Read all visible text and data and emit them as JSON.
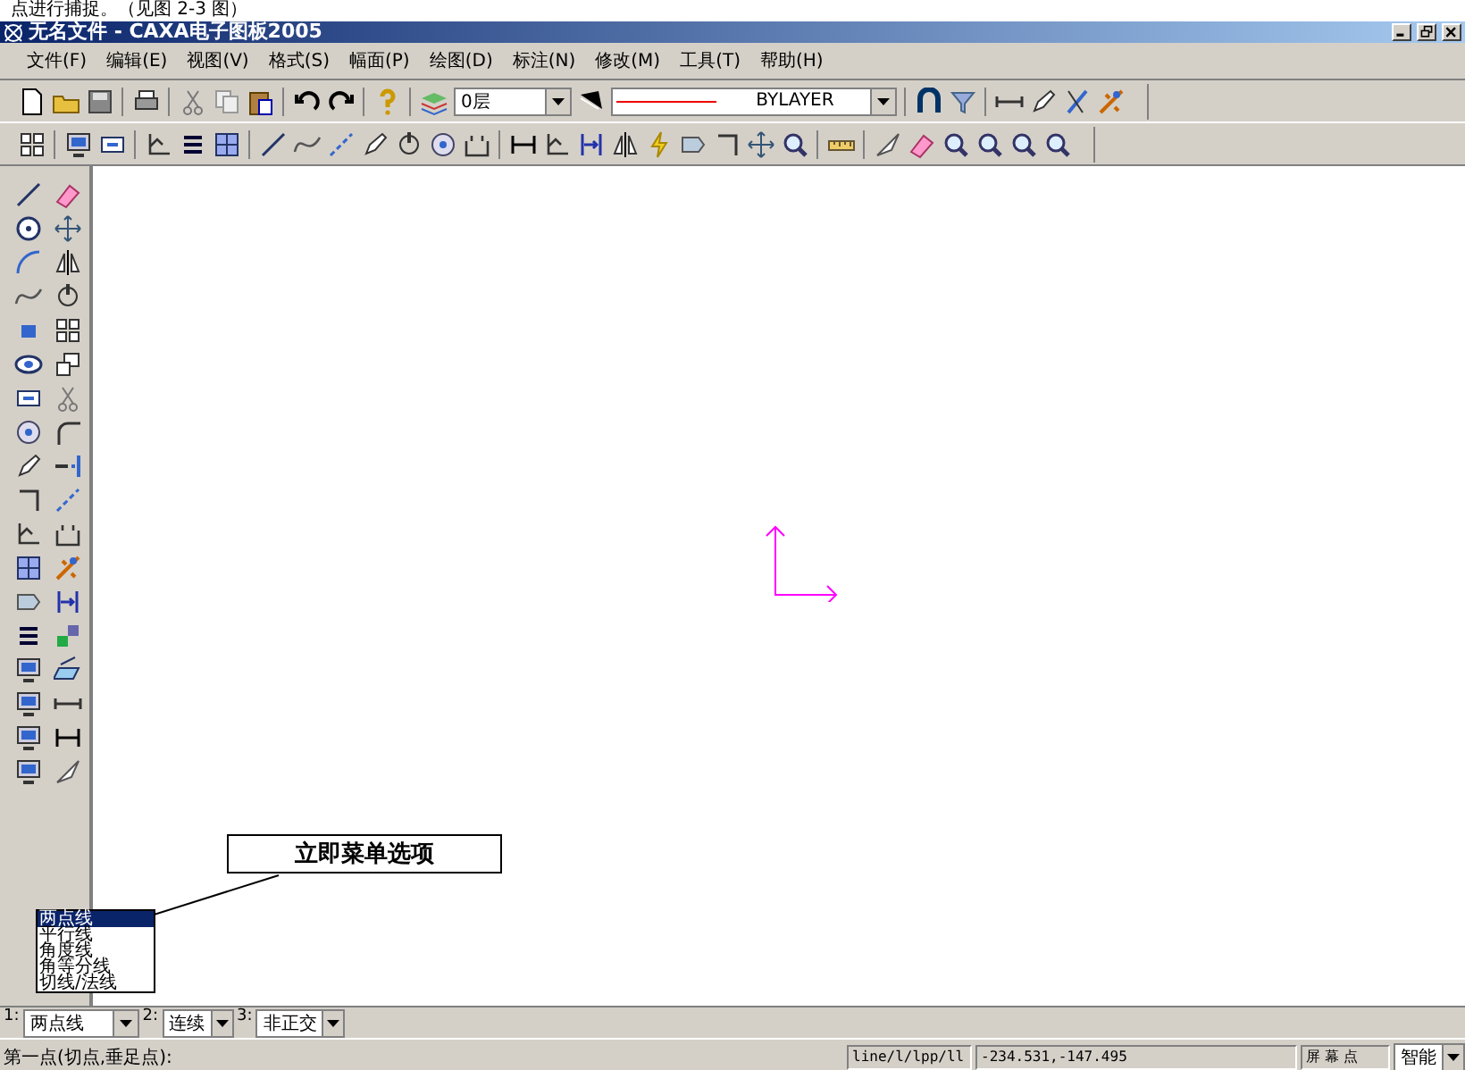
{
  "caption": "点进行捕捉。（见图 2-3 图）",
  "window": {
    "title": "无名文件 - CAXA电子图板2005"
  },
  "menu": [
    "文件(F)",
    "编辑(E)",
    "视图(V)",
    "格式(S)",
    "幅面(P)",
    "绘图(D)",
    "标注(N)",
    "修改(M)",
    "工具(T)",
    "帮助(H)"
  ],
  "toolbar": {
    "layer": "0层",
    "linetype": "BYLAYER"
  },
  "callout": {
    "text": "立即菜单选项"
  },
  "option_list": [
    {
      "label": "两点线",
      "selected": true
    },
    {
      "label": "平行线",
      "selected": false
    },
    {
      "label": "角度线",
      "selected": false
    },
    {
      "label": "角等分线",
      "selected": false
    },
    {
      "label": "切线/法线",
      "selected": false
    }
  ],
  "immediate_menu": [
    {
      "index": "1:",
      "value": "两点线"
    },
    {
      "index": "2:",
      "value": "连续"
    },
    {
      "index": "3:",
      "value": "非正交"
    }
  ],
  "status_bar": {
    "prompt": "第一点(切点,垂足点):",
    "command": "line/l/lpp/ll",
    "coordinates": "-234.531,-147.495",
    "point_mode": "屏 幕 点",
    "snap": "智能"
  }
}
